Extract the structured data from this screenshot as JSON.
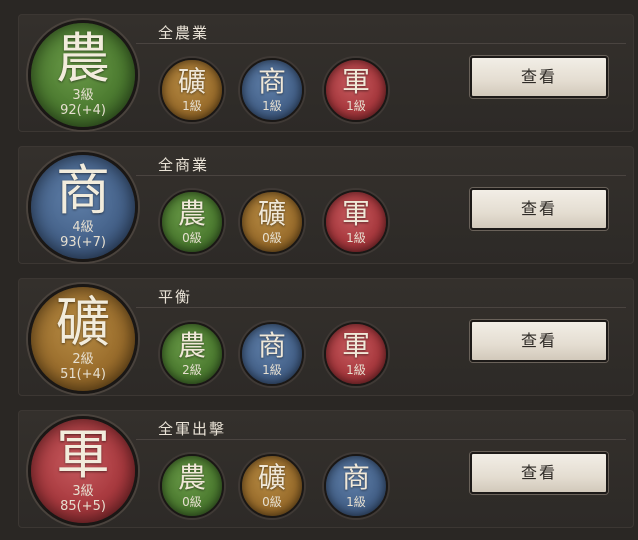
{
  "glyphs": {
    "agriculture": "農",
    "commerce": "商",
    "mining": "礦",
    "military": "軍"
  },
  "colors": {
    "agriculture": "#4c7b30",
    "commerce": "#45628a",
    "mining": "#9a6d2c",
    "military": "#a8393e",
    "panel": "#2d2a27",
    "button": "#e4ddd1"
  },
  "view_label": "查看",
  "cards": [
    {
      "title": "全農業",
      "main": {
        "glyph": "農",
        "level": "3級",
        "score": "92(+4)",
        "color": "green"
      },
      "subs": [
        {
          "glyph": "礦",
          "level": "1級",
          "color": "orange"
        },
        {
          "glyph": "商",
          "level": "1級",
          "color": "blue"
        },
        {
          "glyph": "軍",
          "level": "1級",
          "color": "red"
        }
      ]
    },
    {
      "title": "全商業",
      "main": {
        "glyph": "商",
        "level": "4級",
        "score": "93(+7)",
        "color": "blue"
      },
      "subs": [
        {
          "glyph": "農",
          "level": "0級",
          "color": "green"
        },
        {
          "glyph": "礦",
          "level": "0級",
          "color": "orange"
        },
        {
          "glyph": "軍",
          "level": "1級",
          "color": "red"
        }
      ]
    },
    {
      "title": "平衡",
      "main": {
        "glyph": "礦",
        "level": "2級",
        "score": "51(+4)",
        "color": "orange"
      },
      "subs": [
        {
          "glyph": "農",
          "level": "2級",
          "color": "green"
        },
        {
          "glyph": "商",
          "level": "1級",
          "color": "blue"
        },
        {
          "glyph": "軍",
          "level": "1級",
          "color": "red"
        }
      ]
    },
    {
      "title": "全軍出擊",
      "main": {
        "glyph": "軍",
        "level": "3級",
        "score": "85(+5)",
        "color": "red"
      },
      "subs": [
        {
          "glyph": "農",
          "level": "0級",
          "color": "green"
        },
        {
          "glyph": "礦",
          "level": "0級",
          "color": "orange"
        },
        {
          "glyph": "商",
          "level": "1級",
          "color": "blue"
        }
      ]
    }
  ]
}
